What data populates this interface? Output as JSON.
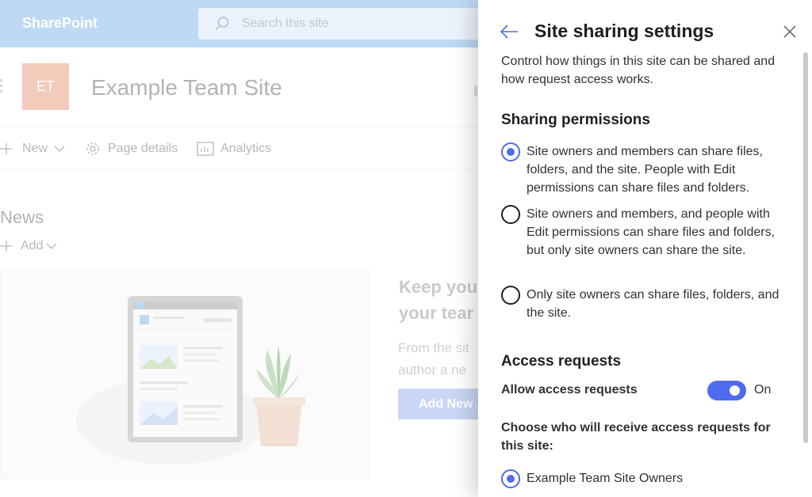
{
  "app": {
    "brand": "SharePoint"
  },
  "search": {
    "placeholder": "Search this site"
  },
  "site": {
    "logo_initials": "ET",
    "title": "Example Team Site"
  },
  "command_bar": {
    "new_label": "New",
    "page_details_label": "Page details",
    "analytics_label": "Analytics"
  },
  "news": {
    "title": "News",
    "add_label": "Add",
    "promo_heading_1": "Keep you",
    "promo_heading_2": "your tear",
    "promo_text_1": "From the sit",
    "promo_text_2": "author a ne",
    "add_news_label": "Add New"
  },
  "panel": {
    "title": "Site sharing settings",
    "description": "Control how things in this site can be shared and how request access works.",
    "sharing": {
      "heading": "Sharing permissions",
      "options": [
        {
          "label": "Site owners and members can share files, folders, and the site. People with Edit permissions can share files and folders.",
          "selected": true
        },
        {
          "label": "Site owners and members, and people with Edit permissions can share files and folders, but only site owners can share the site.",
          "selected": false
        },
        {
          "label": "Only site owners can share files, folders, and the site.",
          "selected": false
        }
      ]
    },
    "access": {
      "heading": "Access requests",
      "allow_label": "Allow access requests",
      "toggle_state": "On",
      "choose_label": "Choose who will receive access requests for this site:",
      "recipient_option": "Example Team Site Owners"
    }
  },
  "colors": {
    "accent": "#4f6bed",
    "topbar": "#a9cdf0",
    "site_logo": "#f1b8a4"
  }
}
